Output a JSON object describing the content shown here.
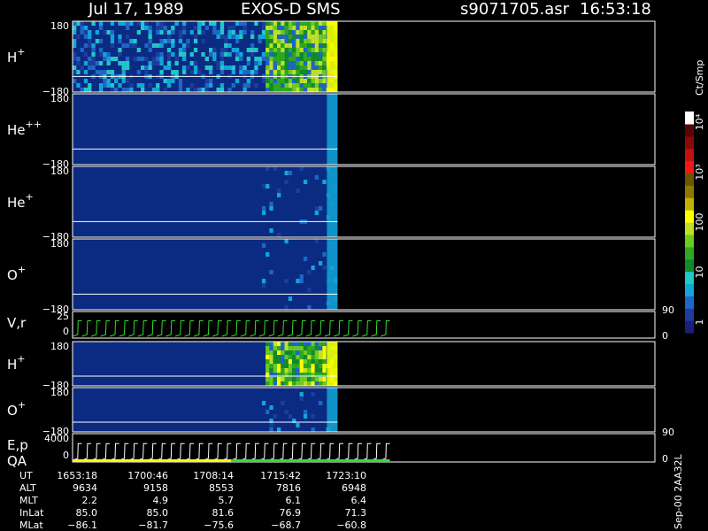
{
  "header": {
    "date": "Jul 17, 1989",
    "instrument": "EXOS-D SMS",
    "file": "s9071705.asr",
    "time": "16:53:18"
  },
  "colors": {
    "background": "#000000",
    "panel_fill": "#0b2a82",
    "frame": "#ffffff",
    "trace": "#ffffff",
    "line_green": "#33dd33",
    "line_yellow": "#ffff00"
  },
  "colorbar": {
    "unit": "Ct/Smp",
    "tick_labels": [
      "1",
      "10",
      "100",
      "10³",
      "10⁴"
    ],
    "scale": "log",
    "range": [
      1,
      10000
    ],
    "colors": [
      "#1a1f7a",
      "#1c3d9c",
      "#1e66c7",
      "#11a6d6",
      "#22c7c8",
      "#118a2a",
      "#2fa820",
      "#6acb22",
      "#bfe027",
      "#ffff00",
      "#c4b000",
      "#8c7a00",
      "#6b5600",
      "#f21818",
      "#c21010",
      "#8a0909",
      "#5a0404",
      "#ffffff"
    ]
  },
  "right_scale": {
    "upper": "90",
    "lower": "0",
    "upper2": "90",
    "lower2": "0"
  },
  "side_label": "Sep-00 2AA32L",
  "chart_data": [
    {
      "type": "heatmap",
      "species": "H",
      "charge": "+",
      "yticks": [
        "180",
        "−180"
      ],
      "ylim": [
        -180,
        180
      ],
      "active_until_x": 0.455,
      "intense_from_x": 0.33
    },
    {
      "type": "heatmap",
      "species": "He",
      "charge": "++",
      "yticks": [
        "180",
        "−180"
      ],
      "ylim": [
        -180,
        180
      ],
      "active_until_x": 0.455,
      "intense_from_x": null
    },
    {
      "type": "heatmap",
      "species": "He",
      "charge": "+",
      "yticks": [
        "180",
        "−180"
      ],
      "ylim": [
        -180,
        180
      ],
      "active_until_x": 0.455,
      "intense_from_x": 0.42
    },
    {
      "type": "heatmap",
      "species": "O",
      "charge": "+",
      "yticks": [
        "180",
        "−180"
      ],
      "ylim": [
        -180,
        180
      ],
      "active_until_x": 0.455,
      "intense_from_x": 0.42
    },
    {
      "type": "line",
      "species": "V,r",
      "yticks": [
        "25",
        "0"
      ],
      "ylim": [
        0,
        25
      ]
    },
    {
      "type": "heatmap",
      "species": "H",
      "charge": "+",
      "yticks": [
        "180",
        "−180"
      ],
      "ylim": [
        -180,
        180
      ],
      "active_until_x": 0.455,
      "intense_from_x": 0.33
    },
    {
      "type": "heatmap",
      "species": "O",
      "charge": "+",
      "yticks": [
        "180",
        "−180"
      ],
      "ylim": [
        -180,
        180
      ],
      "active_until_x": 0.455,
      "intense_from_x": 0.42
    },
    {
      "type": "line",
      "species": "E,p",
      "species2": "QA",
      "yticks": [
        "4000",
        "0"
      ],
      "ylim": [
        0,
        4000
      ]
    }
  ],
  "ephemeris": {
    "rows": [
      {
        "label": "UT",
        "values": [
          "1653:18",
          "1700:46",
          "1708:14",
          "1715:42",
          "1723:10"
        ]
      },
      {
        "label": "ALT",
        "values": [
          "9634",
          "9158",
          "8553",
          "7816",
          "6948"
        ]
      },
      {
        "label": "MLT",
        "values": [
          "2.2",
          "4.9",
          "5.7",
          "6.1",
          "6.4"
        ]
      },
      {
        "label": "InLat",
        "values": [
          "85.0",
          "85.0",
          "81.6",
          "76.9",
          "71.3"
        ]
      },
      {
        "label": "MLat",
        "values": [
          "−86.1",
          "−81.7",
          "−75.6",
          "−68.7",
          "−60.8"
        ]
      }
    ]
  }
}
